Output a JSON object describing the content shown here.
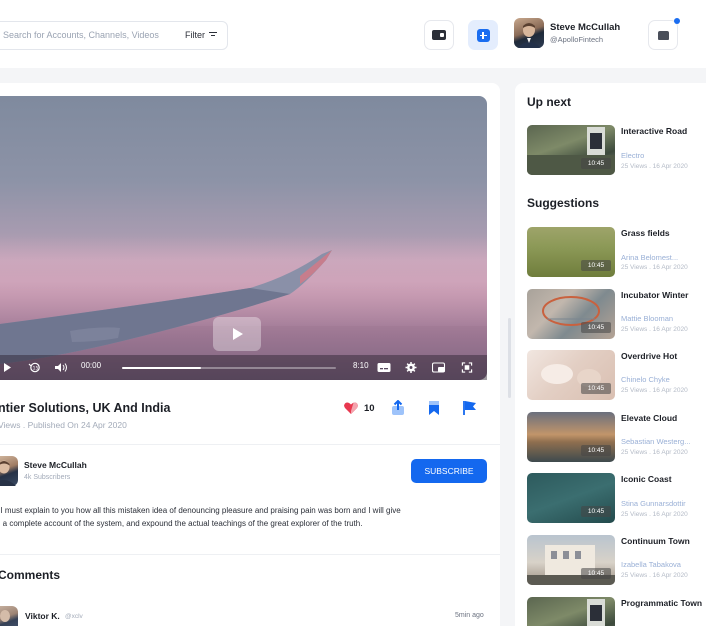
{
  "search": {
    "placeholder": "Search for Accounts, Channels, Videos",
    "filter_label": "Filter"
  },
  "profile": {
    "name": "Steve McCullah",
    "handle": "@ApolloFintech"
  },
  "player": {
    "current_time": "00:00",
    "duration": "8:10",
    "progress": 0.37
  },
  "video": {
    "title": "ntier Solutions, UK And India",
    "meta": "Views . Published On 24 Apr 2020",
    "likes": "10"
  },
  "channel": {
    "name": "Steve McCullah",
    "subscribers": "4k Subscribers",
    "subscribe_label": "SUBSCRIBE"
  },
  "description": {
    "line1": ": I must explain to you how all this mistaken idea of denouncing pleasure and praising pain was born and I will give",
    "line2": "u a complete account of the system, and expound the actual teachings of the great explorer of the truth."
  },
  "comments": {
    "title": "Comments",
    "first": {
      "name": "Viktor K.",
      "handle": "@xclv",
      "time": "5min ago"
    }
  },
  "up_next": {
    "heading": "Up next",
    "items": [
      {
        "title": "Interactive Road",
        "author": "Electro",
        "stats": "25 Views . 16 Apr 2020",
        "duration": "10:45"
      }
    ]
  },
  "suggestions": {
    "heading": "Suggestions",
    "items": [
      {
        "title": "Grass fields",
        "author": "Arina Belomest...",
        "stats": "25 Views . 16 Apr 2020",
        "duration": "10:45"
      },
      {
        "title": "Incubator Winter",
        "author": "Mattie Blooman",
        "stats": "25 Views . 16 Apr 2020",
        "duration": "10:45"
      },
      {
        "title": "Overdrive Hot",
        "author": "Chinelo Chyke",
        "stats": "25 Views . 16 Apr 2020",
        "duration": "10:45"
      },
      {
        "title": "Elevate Cloud",
        "author": "Sebastian Westerg...",
        "stats": "25 Views . 16 Apr 2020",
        "duration": "10:45"
      },
      {
        "title": "Iconic Coast",
        "author": "Stina Gunnarsdottir",
        "stats": "25 Views . 16 Apr 2020",
        "duration": "10:45"
      },
      {
        "title": "Continuum Town",
        "author": "Izabella Tabakova",
        "stats": "25 Views . 16 Apr 2020",
        "duration": "10:45"
      },
      {
        "title": "Programmatic Town",
        "author": "",
        "stats": "",
        "duration": ""
      }
    ]
  },
  "colors": {
    "accent": "#1468ef",
    "like": "#e8384f",
    "link": "#9ab0d6"
  },
  "icons": [
    "wallet-icon",
    "add-icon",
    "bell-icon",
    "filter-icon",
    "play-icon",
    "heart-icon",
    "share-icon",
    "bookmark-icon",
    "flag-icon",
    "settings-icon",
    "fullscreen-icon",
    "captions-icon",
    "volume-icon",
    "replay-15-icon",
    "miniplayer-icon"
  ]
}
